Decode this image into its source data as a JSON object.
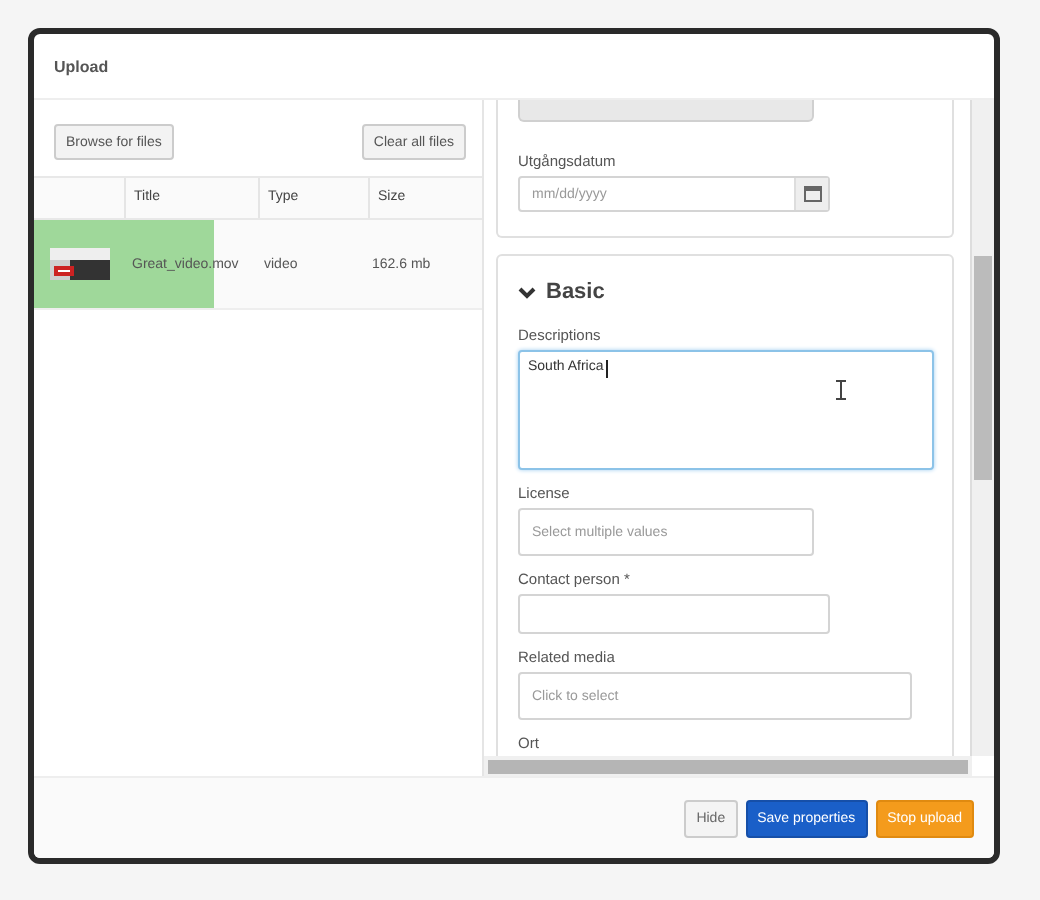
{
  "window": {
    "title": "Upload"
  },
  "toolbar": {
    "buttons": [
      {
        "label": "Browse for files"
      },
      {
        "label": "Clear all files"
      }
    ]
  },
  "table": {
    "columns": [
      "Title",
      "Type",
      "Size"
    ],
    "rows": [
      {
        "title": "Great_video.mov",
        "type": "video",
        "size": "162.6 mb",
        "level": 0.4
      }
    ]
  },
  "properties": {
    "top_section": {
      "fields": [
        {
          "label": "Utgångsdatum",
          "placeholder": "mm/dd/yyyy",
          "kind": "date"
        }
      ]
    },
    "section": {
      "title": "Basic",
      "expanded": true,
      "fields": [
        {
          "label": "Descriptions",
          "value": "South Africa",
          "kind": "textarea",
          "focused": true
        },
        {
          "label": "License",
          "placeholder": "Select multiple values",
          "kind": "select"
        },
        {
          "label": "Contact person *",
          "kind": "text"
        },
        {
          "label": "Related media",
          "placeholder": "Click to select",
          "kind": "picker"
        },
        {
          "label": "Ort",
          "kind": "label"
        }
      ]
    }
  },
  "footer": {
    "buttons": [
      {
        "label": "Hide",
        "kind": "default"
      },
      {
        "label": "Save properties",
        "kind": "primary"
      },
      {
        "label": "Stop upload",
        "kind": "warning"
      }
    ]
  }
}
